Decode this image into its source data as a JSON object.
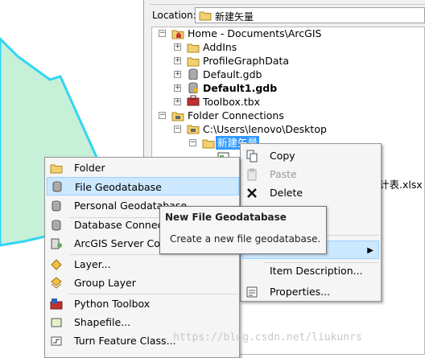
{
  "location": {
    "label": "Location:",
    "value": "新建矢量"
  },
  "tree": {
    "home": "Home - Documents\\ArcGIS",
    "addins": "AddIns",
    "profile": "ProfileGraphData",
    "defaultgdb": "Default.gdb",
    "default1gdb": "Default1.gdb",
    "toolbox": "Toolbox.tbx",
    "folder_connections": "Folder Connections",
    "desktop": "C:\\Users\\lenovo\\Desktop",
    "new_folder": "新建矢量",
    "xlsx_fragment": "计表.xlsx",
    "expand_plus": "+",
    "expand_minus": "−"
  },
  "right_menu": {
    "copy": "Copy",
    "paste": "Paste",
    "delete": "Delete",
    "item_description": "Item Description...",
    "properties": "Properties..."
  },
  "new_menu": {
    "items": [
      "Folder",
      "File Geodatabase",
      "Personal Geodatabase",
      "Database Connection...",
      "ArcGIS Server Connection...",
      "Layer...",
      "Group Layer",
      "Python Toolbox",
      "Shapefile...",
      "Turn Feature Class..."
    ]
  },
  "tooltip": {
    "title": "New File Geodatabase",
    "desc": "Create a new file geodatabase."
  },
  "watermark": "https://blog.csdn.net/liukunrs"
}
